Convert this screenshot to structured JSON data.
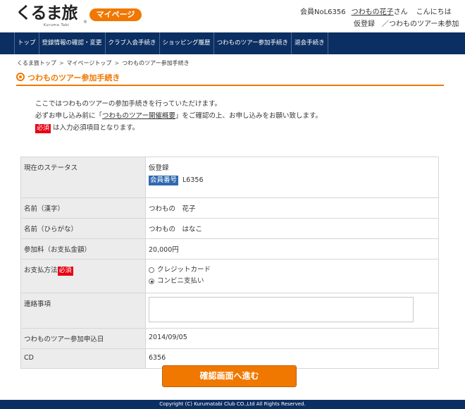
{
  "header": {
    "logo_text": "くるま旅",
    "logo_sub": "Kuruma Tabi",
    "logo_reg": "®",
    "mypage_label": "マイページ",
    "member_prefix": "会員NoL6356",
    "user_name": "つわもの花子",
    "user_suffix": "さん",
    "greeting": "こんにちは",
    "status_line": "仮登録　／つわものツアー未参加"
  },
  "nav": {
    "items": [
      "トップ",
      "登録情報の確認・変更",
      "クラブ入会手続き",
      "ショッピング履歴",
      "つわものツアー参加手続き",
      "退会手続き"
    ]
  },
  "breadcrumb": [
    "くるま旅トップ",
    "マイページトップ",
    "つわものツアー参加手続き"
  ],
  "breadcrumb_sep": ">",
  "page_title": "つわものツアー参加手続き",
  "intro": {
    "line1": "ここではつわものツアーの参加手続きを行っていただけます。",
    "line2_pre": "必ずお申し込み前に「",
    "line2_link": "つわものツアー開催概要",
    "line2_post": "」をご確認の上、お申し込みをお願い致します。",
    "required_badge": "必須",
    "line3": "は入力必須項目となります。"
  },
  "form": {
    "status_label": "現在のステータス",
    "status_value": "仮登録",
    "member_no_label": "会員番号",
    "member_no_value": "L6356",
    "name_kanji_label": "名前（漢字）",
    "name_kanji_value": "つわもの　花子",
    "name_kana_label": "名前（ひらがな）",
    "name_kana_value": "つわもの　はなこ",
    "fee_label": "参加料（お支払金額）",
    "fee_value": "20,000円",
    "payment_label": "お支払方法",
    "payment_required": "必須",
    "payment_options": [
      {
        "label": "クレジットカード",
        "checked": false
      },
      {
        "label": "コンビニ支払い",
        "checked": true
      }
    ],
    "contact_label": "連絡事項",
    "contact_value": "",
    "apply_date_label": "つわものツアー参加申込日",
    "apply_date_value": "2014/09/05",
    "cd_label": "CD",
    "cd_value": "6356"
  },
  "submit_label": "確認画面へ進む",
  "footer": "Copyright (C) Kurumatabi Club CO.,Ltd All Rights Reserved.",
  "colors": {
    "accent": "#f07800",
    "nav_bg": "#0c2f63",
    "required": "#e60012",
    "pill": "#2f6ab1"
  }
}
